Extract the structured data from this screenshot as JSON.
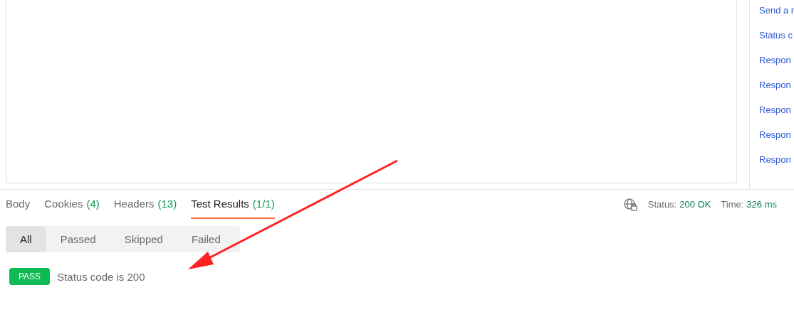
{
  "snippets": [
    "Send a r",
    "Status c",
    "Respon",
    "Respon",
    "Respon",
    "Respon",
    "Respon"
  ],
  "response_tabs": [
    {
      "label": "Body",
      "selected": false
    },
    {
      "label": "Cookies",
      "count": "(4)",
      "selected": false
    },
    {
      "label": "Headers",
      "count": "(13)",
      "selected": false
    },
    {
      "label": "Test Results",
      "count": "(1/1)",
      "selected": true
    }
  ],
  "status": {
    "status_label": "Status:",
    "status_value": "200 OK",
    "time_label": "Time:",
    "time_value": "326 ms"
  },
  "filters": [
    {
      "label": "All",
      "selected": true
    },
    {
      "label": "Passed",
      "selected": false
    },
    {
      "label": "Skipped",
      "selected": false
    },
    {
      "label": "Failed",
      "selected": false
    }
  ],
  "results": [
    {
      "badge": "PASS",
      "name": "Status code is 200"
    }
  ]
}
